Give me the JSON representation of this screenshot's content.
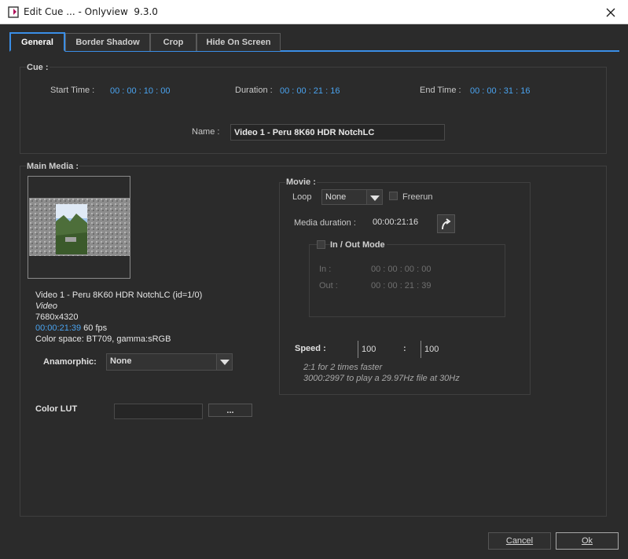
{
  "window": {
    "title": "Edit Cue ... - Onlyview  9.3.0"
  },
  "tabs": [
    {
      "label": "General",
      "active": true
    },
    {
      "label": "Border Shadow",
      "active": false
    },
    {
      "label": "Crop",
      "active": false
    },
    {
      "label": "Hide On Screen",
      "active": false
    }
  ],
  "cue": {
    "title": "Cue :",
    "start_label": "Start Time :",
    "start_value": "00 : 00 : 10 : 00",
    "duration_label": "Duration :",
    "duration_value": "00 : 00 : 21 : 16",
    "end_label": "End Time :",
    "end_value": "00 : 00 : 31 : 16",
    "name_label": "Name :",
    "name_value": "Video 1 - Peru 8K60 HDR NotchLC"
  },
  "main_media": {
    "title": "Main Media :",
    "info_name": "Video 1 - Peru 8K60 HDR NotchLC (id=1/0)",
    "info_type": "Video",
    "info_resolution": "7680x4320",
    "info_duration": "00:00:21:39",
    "info_fps": " 60 fps",
    "info_color": "Color space: BT709, gamma:sRGB",
    "anamorphic_label": "Anamorphic:",
    "anamorphic_value": "None",
    "color_lut_label": "Color LUT",
    "color_lut_value": "",
    "browse_label": "..."
  },
  "movie": {
    "title": "Movie :",
    "loop_label": "Loop",
    "loop_value": "None",
    "freerun_label": "Freerun",
    "media_duration_label": "Media duration :",
    "media_duration_value": "00:00:21:16",
    "inout_label": "In / Out Mode",
    "in_label": "In :",
    "in_value": "00 : 00 : 00 : 00",
    "out_label": "Out :",
    "out_value": "00 : 00 : 21 : 39",
    "speed_label": "Speed :",
    "speed_num": "100",
    "speed_sep": ":",
    "speed_den": "100",
    "hint1": "2:1 for 2 times faster",
    "hint2": "3000:2997 to play a 29.97Hz file at 30Hz"
  },
  "buttons": {
    "cancel": "Cancel",
    "ok": "Ok"
  },
  "colors": {
    "accent": "#3a8ee6",
    "timecode": "#4aa3ef",
    "background": "#2b2b2b"
  }
}
